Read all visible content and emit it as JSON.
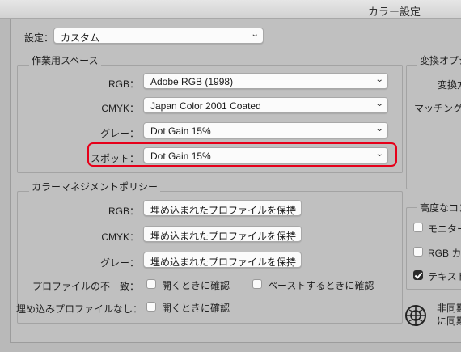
{
  "window": {
    "title": "カラー設定"
  },
  "settings": {
    "label": "設定：",
    "value": "カスタム"
  },
  "working_spaces": {
    "title": "作業用スペース",
    "rgb_label": "RGB：",
    "rgb_value": "Adobe RGB (1998)",
    "cmyk_label": "CMYK：",
    "cmyk_value": "Japan Color 2001 Coated",
    "gray_label": "グレー：",
    "gray_value": "Dot Gain 15%",
    "spot_label": "スポット：",
    "spot_value": "Dot Gain 15%"
  },
  "policies": {
    "title": "カラーマネジメントポリシー",
    "rgb_label": "RGB：",
    "rgb_value": "埋め込まれたプロファイルを保持",
    "cmyk_label": "CMYK：",
    "cmyk_value": "埋め込まれたプロファイルを保持",
    "gray_label": "グレー：",
    "gray_value": "埋め込まれたプロファイルを保持",
    "mismatch_label": "プロファイルの不一致：",
    "mismatch_open": {
      "label": "開くときに確認",
      "checked": false
    },
    "mismatch_paste": {
      "label": "ペーストするときに確認",
      "checked": false
    },
    "missing_label": "埋め込みプロファイルなし：",
    "missing_open": {
      "label": "開くときに確認",
      "checked": false
    }
  },
  "conversion": {
    "title": "変換オプシ",
    "engine_label": "変換方",
    "matching_label": "マッチングフ"
  },
  "advanced": {
    "title": "高度なコン",
    "monitor": {
      "label": "モニター",
      "checked": false
    },
    "rgb_blend": {
      "label": "RGB カ",
      "checked": false
    },
    "text_blend": {
      "label": "テキスト",
      "checked": true
    }
  },
  "sync": {
    "line1": "非同期",
    "line2": "に同期",
    "icon": "sync-globe-icon"
  },
  "colors": {
    "highlight": "#e6001a",
    "background": "#c0c0c0"
  }
}
